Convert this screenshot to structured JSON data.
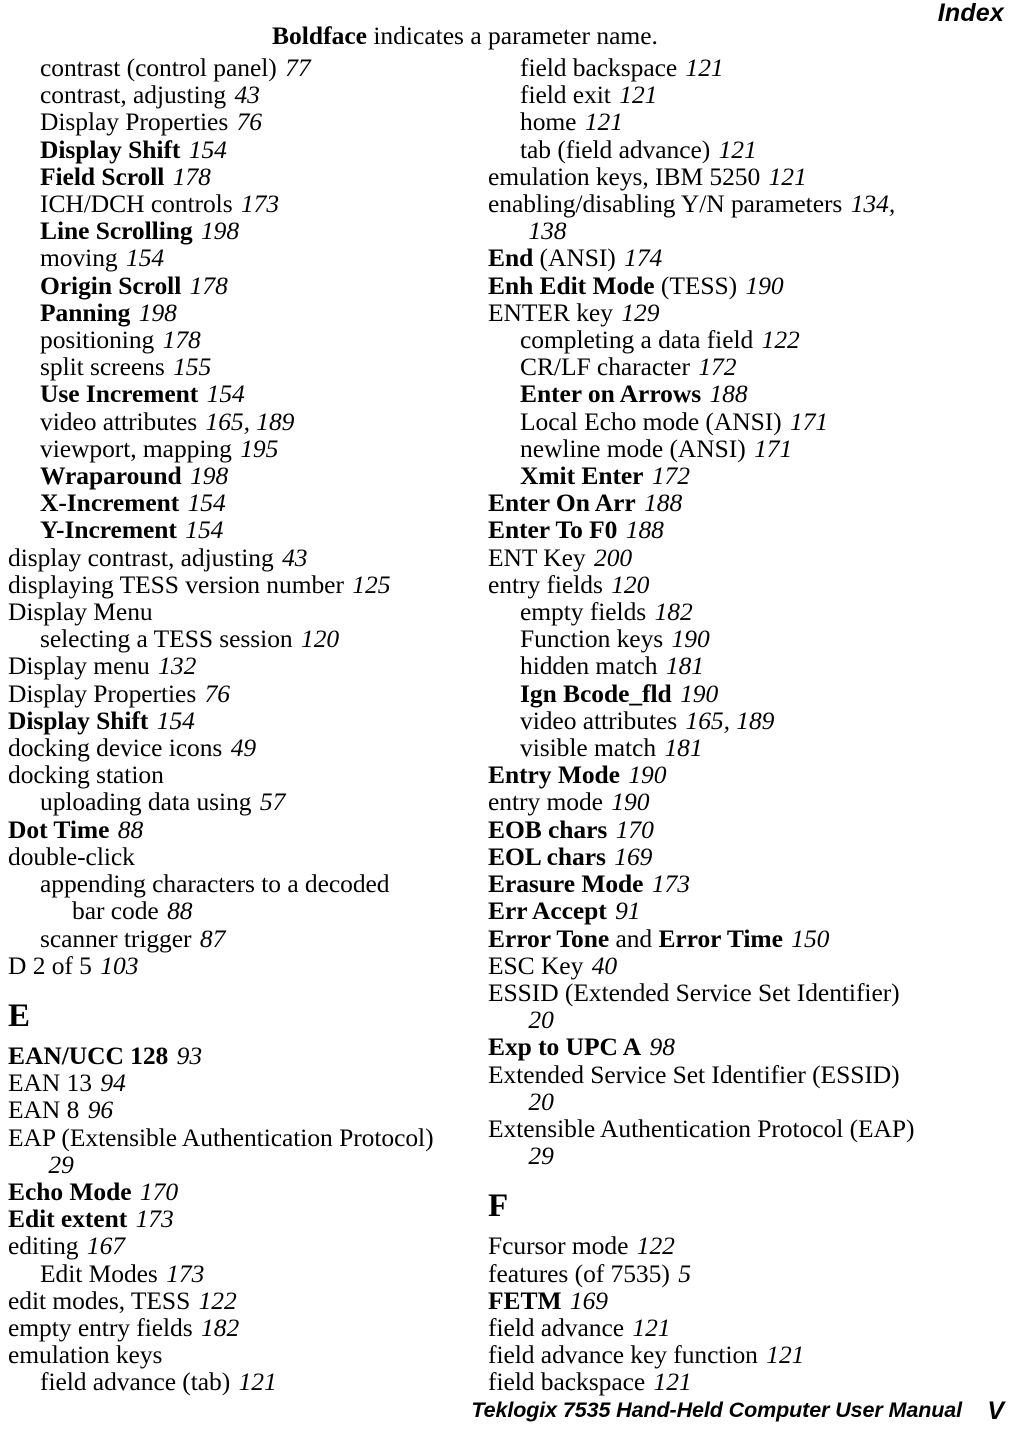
{
  "header": {
    "running_head": "Index",
    "note_bold": "Boldface",
    "note_rest": " indicates a parameter name."
  },
  "footer": {
    "manual_title": "Teklogix 7535 Hand-Held Computer User Manual",
    "page_number": "V"
  },
  "columns": {
    "left": [
      {
        "kind": "entry",
        "level": 1,
        "text": "contrast (control panel)",
        "bold": false,
        "page": "77"
      },
      {
        "kind": "entry",
        "level": 1,
        "text": "contrast, adjusting",
        "bold": false,
        "page": "43"
      },
      {
        "kind": "entry",
        "level": 1,
        "text": "Display Properties",
        "bold": false,
        "page": "76"
      },
      {
        "kind": "entry",
        "level": 1,
        "text": "Display Shift",
        "bold": true,
        "page": "154"
      },
      {
        "kind": "entry",
        "level": 1,
        "text": "Field Scroll",
        "bold": true,
        "page": "178"
      },
      {
        "kind": "entry",
        "level": 1,
        "text": "ICH/DCH controls",
        "bold": false,
        "page": "173"
      },
      {
        "kind": "entry",
        "level": 1,
        "text": "Line Scrolling",
        "bold": true,
        "page": "198"
      },
      {
        "kind": "entry",
        "level": 1,
        "text": "moving",
        "bold": false,
        "page": "154"
      },
      {
        "kind": "entry",
        "level": 1,
        "text": "Origin Scroll",
        "bold": true,
        "page": "178"
      },
      {
        "kind": "entry",
        "level": 1,
        "text": "Panning",
        "bold": true,
        "page": "198"
      },
      {
        "kind": "entry",
        "level": 1,
        "text": "positioning",
        "bold": false,
        "page": "178"
      },
      {
        "kind": "entry",
        "level": 1,
        "text": "split screens",
        "bold": false,
        "page": "155"
      },
      {
        "kind": "entry",
        "level": 1,
        "text": "Use Increment",
        "bold": true,
        "page": "154"
      },
      {
        "kind": "entry",
        "level": 1,
        "text": "video attributes",
        "bold": false,
        "page": "165, 189"
      },
      {
        "kind": "entry",
        "level": 1,
        "text": "viewport, mapping",
        "bold": false,
        "page": "195"
      },
      {
        "kind": "entry",
        "level": 1,
        "text": "Wraparound",
        "bold": true,
        "page": "198"
      },
      {
        "kind": "entry",
        "level": 1,
        "text": "X-Increment",
        "bold": true,
        "page": "154"
      },
      {
        "kind": "entry",
        "level": 1,
        "text": "Y-Increment",
        "bold": true,
        "page": "154"
      },
      {
        "kind": "entry",
        "level": 0,
        "text": "display contrast, adjusting",
        "bold": false,
        "page": "43"
      },
      {
        "kind": "entry",
        "level": 0,
        "text": "displaying TESS version number",
        "bold": false,
        "page": "125"
      },
      {
        "kind": "entry",
        "level": 0,
        "text": "Display Menu",
        "bold": false,
        "page": ""
      },
      {
        "kind": "entry",
        "level": 1,
        "text": "selecting a TESS session",
        "bold": false,
        "page": "120"
      },
      {
        "kind": "entry",
        "level": 0,
        "text": "Display menu",
        "bold": false,
        "page": "132"
      },
      {
        "kind": "entry",
        "level": 0,
        "text": "Display Properties",
        "bold": false,
        "page": "76"
      },
      {
        "kind": "entry",
        "level": 0,
        "text": "Display Shift",
        "bold": true,
        "page": "154"
      },
      {
        "kind": "entry",
        "level": 0,
        "text": "docking device icons",
        "bold": false,
        "page": "49"
      },
      {
        "kind": "entry",
        "level": 0,
        "text": "docking station",
        "bold": false,
        "page": ""
      },
      {
        "kind": "entry",
        "level": 1,
        "text": "uploading data using",
        "bold": false,
        "page": "57"
      },
      {
        "kind": "entry",
        "level": 0,
        "text": "Dot Time",
        "bold": true,
        "page": "88"
      },
      {
        "kind": "entry",
        "level": 0,
        "text": "double-click",
        "bold": false,
        "page": ""
      },
      {
        "kind": "entry",
        "level": 1,
        "text": "appending characters to a decoded",
        "bold": false,
        "page": ""
      },
      {
        "kind": "entry",
        "level": 2,
        "text": "bar code",
        "bold": false,
        "page": "88"
      },
      {
        "kind": "entry",
        "level": 1,
        "text": "scanner trigger",
        "bold": false,
        "page": "87"
      },
      {
        "kind": "entry",
        "level": 0,
        "text": "D 2 of 5",
        "bold": false,
        "page": "103"
      },
      {
        "kind": "letter",
        "text": "E"
      },
      {
        "kind": "entry",
        "level": 0,
        "text": "EAN/UCC 128",
        "bold": true,
        "page": "93"
      },
      {
        "kind": "entry",
        "level": 0,
        "text": "EAN 13",
        "bold": false,
        "page": "94"
      },
      {
        "kind": "entry",
        "level": 0,
        "text": "EAN 8",
        "bold": false,
        "page": "96"
      },
      {
        "kind": "entry",
        "level": 0,
        "text": "EAP (Extensible Authentication Protocol)",
        "bold": false,
        "page": ""
      },
      {
        "kind": "entry",
        "level": 1,
        "text": "",
        "bold": false,
        "page": "29"
      },
      {
        "kind": "entry",
        "level": 0,
        "text": "Echo Mode",
        "bold": true,
        "page": "170"
      },
      {
        "kind": "entry",
        "level": 0,
        "text": "Edit extent",
        "bold": true,
        "page": "173"
      },
      {
        "kind": "entry",
        "level": 0,
        "text": "editing",
        "bold": false,
        "page": "167"
      },
      {
        "kind": "entry",
        "level": 1,
        "text": "Edit Modes",
        "bold": false,
        "page": "173"
      },
      {
        "kind": "entry",
        "level": 0,
        "text": "edit modes, TESS",
        "bold": false,
        "page": "122"
      },
      {
        "kind": "entry",
        "level": 0,
        "text": "empty entry fields",
        "bold": false,
        "page": "182"
      },
      {
        "kind": "entry",
        "level": 0,
        "text": "emulation keys",
        "bold": false,
        "page": ""
      },
      {
        "kind": "entry",
        "level": 1,
        "text": "field advance (tab)",
        "bold": false,
        "page": "121"
      }
    ],
    "right": [
      {
        "kind": "entry",
        "level": 1,
        "text": "field backspace",
        "bold": false,
        "page": "121"
      },
      {
        "kind": "entry",
        "level": 1,
        "text": "field exit",
        "bold": false,
        "page": "121"
      },
      {
        "kind": "entry",
        "level": 1,
        "text": "home",
        "bold": false,
        "page": "121"
      },
      {
        "kind": "entry",
        "level": 1,
        "text": "tab (field advance)",
        "bold": false,
        "page": "121"
      },
      {
        "kind": "entry",
        "level": 0,
        "text": "emulation keys, IBM 5250",
        "bold": false,
        "page": "121"
      },
      {
        "kind": "entry",
        "level": 0,
        "text": "enabling/disabling Y/N parameters",
        "bold": false,
        "page": "134,"
      },
      {
        "kind": "entry",
        "level": 1,
        "text": "",
        "bold": false,
        "page": "138"
      },
      {
        "kind": "entry",
        "level": 0,
        "text": "End",
        "bold": true,
        "suffix": " (ANSI)",
        "page": "174"
      },
      {
        "kind": "entry",
        "level": 0,
        "text": "Enh Edit Mode",
        "bold": true,
        "suffix": " (TESS)",
        "page": "190"
      },
      {
        "kind": "entry",
        "level": 0,
        "text": "ENTER key",
        "bold": false,
        "page": "129"
      },
      {
        "kind": "entry",
        "level": 1,
        "text": "completing a data field",
        "bold": false,
        "page": "122"
      },
      {
        "kind": "entry",
        "level": 1,
        "text": "CR/LF character",
        "bold": false,
        "page": "172"
      },
      {
        "kind": "entry",
        "level": 1,
        "text": "Enter on Arrows",
        "bold": true,
        "page": "188"
      },
      {
        "kind": "entry",
        "level": 1,
        "text": "Local Echo mode (ANSI)",
        "bold": false,
        "page": "171"
      },
      {
        "kind": "entry",
        "level": 1,
        "text": "newline mode (ANSI)",
        "bold": false,
        "page": "171"
      },
      {
        "kind": "entry",
        "level": 1,
        "text": "Xmit Enter",
        "bold": true,
        "page": "172"
      },
      {
        "kind": "entry",
        "level": 0,
        "text": "Enter On Arr",
        "bold": true,
        "page": "188"
      },
      {
        "kind": "entry",
        "level": 0,
        "text": "Enter To F0",
        "bold": true,
        "page": "188"
      },
      {
        "kind": "entry",
        "level": 0,
        "text": "ENT Key",
        "bold": false,
        "page": "200"
      },
      {
        "kind": "entry",
        "level": 0,
        "text": "entry fields",
        "bold": false,
        "page": "120"
      },
      {
        "kind": "entry",
        "level": 1,
        "text": "empty fields",
        "bold": false,
        "page": "182"
      },
      {
        "kind": "entry",
        "level": 1,
        "text": "Function keys",
        "bold": false,
        "page": "190"
      },
      {
        "kind": "entry",
        "level": 1,
        "text": "hidden match",
        "bold": false,
        "page": "181"
      },
      {
        "kind": "entry",
        "level": 1,
        "text": "Ign Bcode_fld",
        "bold": true,
        "page": "190"
      },
      {
        "kind": "entry",
        "level": 1,
        "text": "video attributes",
        "bold": false,
        "page": "165, 189"
      },
      {
        "kind": "entry",
        "level": 1,
        "text": "visible match",
        "bold": false,
        "page": "181"
      },
      {
        "kind": "entry",
        "level": 0,
        "text": "Entry Mode",
        "bold": true,
        "page": "190"
      },
      {
        "kind": "entry",
        "level": 0,
        "text": "entry mode",
        "bold": false,
        "page": "190"
      },
      {
        "kind": "entry",
        "level": 0,
        "text": "EOB chars",
        "bold": true,
        "page": "170"
      },
      {
        "kind": "entry",
        "level": 0,
        "text": "EOL chars",
        "bold": true,
        "page": "169"
      },
      {
        "kind": "entry",
        "level": 0,
        "text": "Erasure Mode",
        "bold": true,
        "page": "173"
      },
      {
        "kind": "entry",
        "level": 0,
        "text": "Err Accept",
        "bold": true,
        "page": "91"
      },
      {
        "kind": "entry",
        "level": 0,
        "text": "Error Tone",
        "bold": true,
        "mid": " and ",
        "text2": "Error Time",
        "bold2": true,
        "page": "150"
      },
      {
        "kind": "entry",
        "level": 0,
        "text": "ESC Key",
        "bold": false,
        "page": "40"
      },
      {
        "kind": "entry",
        "level": 0,
        "text": "ESSID (Extended Service Set Identifier)",
        "bold": false,
        "page": ""
      },
      {
        "kind": "entry",
        "level": 1,
        "text": "",
        "bold": false,
        "page": "20"
      },
      {
        "kind": "entry",
        "level": 0,
        "text": "Exp to UPC A",
        "bold": true,
        "page": "98"
      },
      {
        "kind": "entry",
        "level": 0,
        "text": "Extended Service Set Identifier (ESSID)",
        "bold": false,
        "page": ""
      },
      {
        "kind": "entry",
        "level": 1,
        "text": "",
        "bold": false,
        "page": "20"
      },
      {
        "kind": "entry",
        "level": 0,
        "text": "Extensible Authentication Protocol (EAP)",
        "bold": false,
        "page": ""
      },
      {
        "kind": "entry",
        "level": 1,
        "text": "",
        "bold": false,
        "page": "29"
      },
      {
        "kind": "letter",
        "text": "F"
      },
      {
        "kind": "entry",
        "level": 0,
        "text": "Fcursor mode",
        "bold": false,
        "page": "122"
      },
      {
        "kind": "entry",
        "level": 0,
        "text": "features (of 7535)",
        "bold": false,
        "page": "5"
      },
      {
        "kind": "entry",
        "level": 0,
        "text": "FETM",
        "bold": true,
        "page": "169"
      },
      {
        "kind": "entry",
        "level": 0,
        "text": "field advance",
        "bold": false,
        "page": "121"
      },
      {
        "kind": "entry",
        "level": 0,
        "text": "field advance key function",
        "bold": false,
        "page": "121"
      },
      {
        "kind": "entry",
        "level": 0,
        "text": "field backspace",
        "bold": false,
        "page": "121"
      }
    ]
  }
}
